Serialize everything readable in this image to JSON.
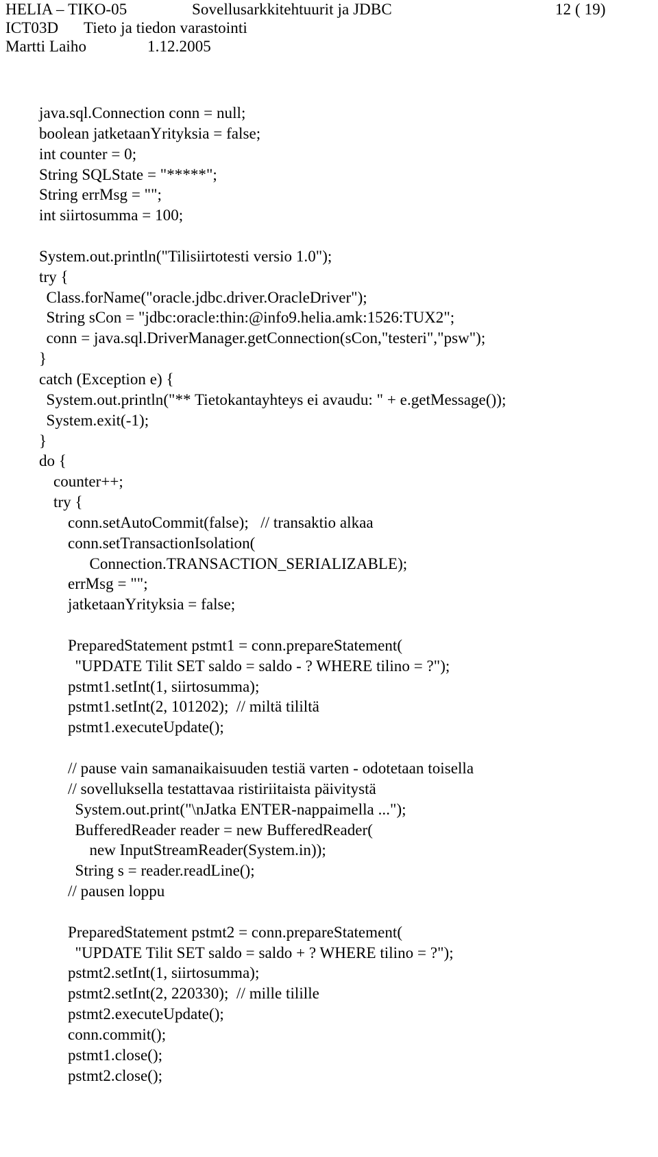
{
  "header": {
    "course_code": "HELIA – TIKO-05",
    "course_title": "Sovellusarkkitehtuurit ja JDBC",
    "page_number": "12 ( 19)",
    "module_code": "ICT03D",
    "module_title": "Tieto ja tiedon varastointi",
    "author": "Martti Laiho",
    "date": "1.12.2005"
  },
  "code": {
    "lines": [
      {
        "indent": 0,
        "text": "java.sql.Connection conn = null;"
      },
      {
        "indent": 0,
        "text": "boolean jatketaanYrityksia = false;"
      },
      {
        "indent": 0,
        "text": "int counter = 0;"
      },
      {
        "indent": 0,
        "text": "String SQLState = \"*****\";"
      },
      {
        "indent": 0,
        "text": "String errMsg = \"\";"
      },
      {
        "indent": 0,
        "text": "int siirtosumma = 100;"
      },
      {
        "indent": 0,
        "text": ""
      },
      {
        "indent": 0,
        "text": "System.out.println(\"Tilisiirtotesti versio 1.0\");"
      },
      {
        "indent": 0,
        "text": "try {"
      },
      {
        "indent": 1,
        "text": "Class.forName(\"oracle.jdbc.driver.OracleDriver\");"
      },
      {
        "indent": 1,
        "text": "String sCon = \"jdbc:oracle:thin:@info9.helia.amk:1526:TUX2\";"
      },
      {
        "indent": 1,
        "text": "conn = java.sql.DriverManager.getConnection(sCon,\"testeri\",\"psw\");"
      },
      {
        "indent": 0,
        "text": "}"
      },
      {
        "indent": 0,
        "text": "catch (Exception e) {"
      },
      {
        "indent": 1,
        "text": "System.out.println(\"** Tietokantayhteys ei avaudu: \" + e.getMessage());"
      },
      {
        "indent": 1,
        "text": "System.exit(-1);"
      },
      {
        "indent": 0,
        "text": "}"
      },
      {
        "indent": 0,
        "text": "do {"
      },
      {
        "indent": 2,
        "text": "counter++;"
      },
      {
        "indent": 2,
        "text": "try {"
      },
      {
        "indent": 4,
        "text": "conn.setAutoCommit(false);   // transaktio alkaa"
      },
      {
        "indent": 4,
        "text": "conn.setTransactionIsolation("
      },
      {
        "indent": 7,
        "text": "Connection.TRANSACTION_SERIALIZABLE);"
      },
      {
        "indent": 4,
        "text": "errMsg = \"\";"
      },
      {
        "indent": 4,
        "text": "jatketaanYrityksia = false;"
      },
      {
        "indent": 0,
        "text": ""
      },
      {
        "indent": 4,
        "text": "PreparedStatement pstmt1 = conn.prepareStatement("
      },
      {
        "indent": 5,
        "text": "\"UPDATE Tilit SET saldo = saldo - ? WHERE tilino = ?\");"
      },
      {
        "indent": 4,
        "text": "pstmt1.setInt(1, siirtosumma);"
      },
      {
        "indent": 4,
        "text": "pstmt1.setInt(2, 101202);  // miltä tililtä"
      },
      {
        "indent": 4,
        "text": "pstmt1.executeUpdate();"
      },
      {
        "indent": 0,
        "text": ""
      },
      {
        "indent": 4,
        "text": "// pause vain samanaikaisuuden testiä varten - odotetaan toisella"
      },
      {
        "indent": 4,
        "text": "// sovelluksella testattavaa ristiriitaista päivitystä"
      },
      {
        "indent": 5,
        "text": "System.out.print(\"\\nJatka ENTER-nappaimella ...\");"
      },
      {
        "indent": 5,
        "text": "BufferedReader reader = new BufferedReader("
      },
      {
        "indent": 7,
        "text": "new InputStreamReader(System.in));"
      },
      {
        "indent": 5,
        "text": "String s = reader.readLine();"
      },
      {
        "indent": 4,
        "text": "// pausen loppu"
      },
      {
        "indent": 0,
        "text": ""
      },
      {
        "indent": 4,
        "text": "PreparedStatement pstmt2 = conn.prepareStatement("
      },
      {
        "indent": 5,
        "text": "\"UPDATE Tilit SET saldo = saldo + ? WHERE tilino = ?\");"
      },
      {
        "indent": 4,
        "text": "pstmt2.setInt(1, siirtosumma);"
      },
      {
        "indent": 4,
        "text": "pstmt2.setInt(2, 220330);  // mille tilille"
      },
      {
        "indent": 4,
        "text": "pstmt2.executeUpdate();"
      },
      {
        "indent": 4,
        "text": "conn.commit();"
      },
      {
        "indent": 4,
        "text": "pstmt1.close();"
      },
      {
        "indent": 4,
        "text": "pstmt2.close();"
      }
    ]
  }
}
